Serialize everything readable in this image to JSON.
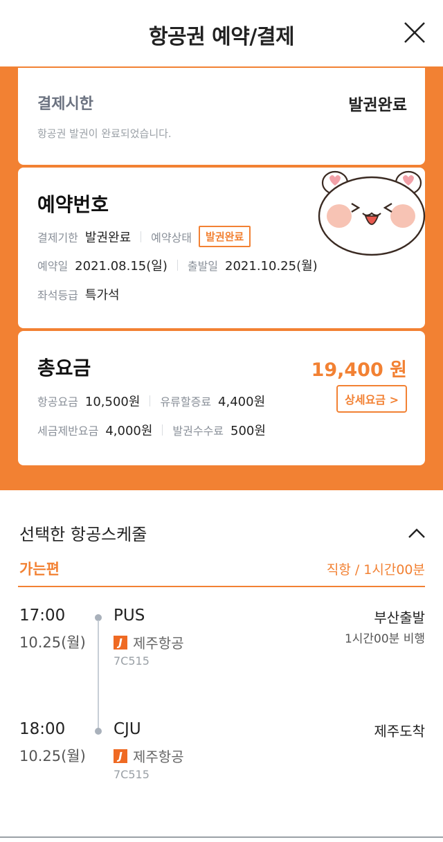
{
  "header": {
    "title": "항공권 예약/결제",
    "close_icon": "close-icon"
  },
  "payment_card": {
    "label": "결제시한",
    "status": "발권완료",
    "description": "항공권 발권이 완료되었습니다."
  },
  "reservation": {
    "title": "예약번호",
    "payment_deadline_label": "결제기한",
    "payment_deadline_value": "발권완료",
    "status_label": "예약상태",
    "status_value": "발권완료",
    "reservation_date_label": "예약일",
    "reservation_date_value": "2021.08.15(일)",
    "departure_date_label": "출발일",
    "departure_date_value": "2021.10.25(월)",
    "seat_class_label": "좌석등급",
    "seat_class_value": "특가석",
    "sticker": "bear-sticker-icon"
  },
  "fare": {
    "title": "총요금",
    "total": "19,400 원",
    "detail_button": "상세요금 >",
    "air_fare_label": "항공요금",
    "air_fare_value": "10,500원",
    "fuel_label": "유류할증료",
    "fuel_value": "4,400원",
    "tax_label": "세금제반요금",
    "tax_value": "4,000원",
    "ticket_fee_label": "발권수수료",
    "ticket_fee_value": "500원"
  },
  "schedule": {
    "title": "선택한 항공스케줄",
    "leg_label": "가는편",
    "leg_info": "직항 / 1시간00분",
    "departure": {
      "time": "17:00",
      "date": "10.25(월)",
      "airport": "PUS",
      "airline": "제주항공",
      "flight_no": "7C515",
      "status": "부산출발",
      "duration": "1시간00분 비행"
    },
    "arrival": {
      "time": "18:00",
      "date": "10.25(월)",
      "airport": "CJU",
      "airline": "제주항공",
      "flight_no": "7C515",
      "status": "제주도착"
    }
  },
  "colors": {
    "accent": "#f28133",
    "airline_logo": "#ef6a23"
  }
}
